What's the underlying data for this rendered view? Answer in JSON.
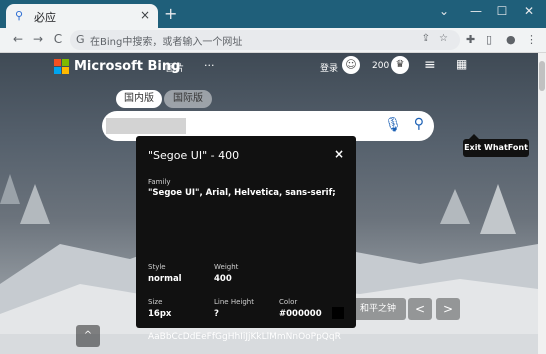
{
  "browser": {
    "tab_title": "必应",
    "tab_close": "×",
    "new_tab": "+",
    "controls": {
      "minimize": "⌄",
      "min": "—",
      "max": "☐",
      "close": "✕"
    },
    "nav": {
      "back": "←",
      "forward": "→",
      "reload": "C"
    },
    "omnibox": {
      "placeholder": "在Bing中搜索，或者输入一个网址"
    }
  },
  "bing": {
    "logo": "Microsoft Bing",
    "nav_images": "图片",
    "more": "···",
    "login": "登录",
    "points": "200",
    "scope_cn": "国内版",
    "scope_intl": "国际版",
    "tooltip": "Exit WhatFont",
    "caption": "和平之钟",
    "prev": "<",
    "next": ">",
    "up": "^"
  },
  "whatfont": {
    "heading": "\"Segoe UI\" - 400",
    "close": "×",
    "family_label": "Family",
    "family_value": "\"Segoe UI\", Arial, Helvetica, sans-serif;",
    "style_label": "Style",
    "style_value": "normal",
    "weight_label": "Weight",
    "weight_value": "400",
    "size_label": "Size",
    "size_value": "16px",
    "lineheight_label": "Line Height",
    "lineheight_value": "?",
    "color_label": "Color",
    "color_value": "#000000",
    "sample": "AaBbCcDdEeFfGgHhIiJjKkLlMmNnOoPpQqR",
    "twitter": "twitter-icon"
  },
  "colors": {
    "tabstrip": "#1f5f7a",
    "accent": "#1a5fb4"
  }
}
